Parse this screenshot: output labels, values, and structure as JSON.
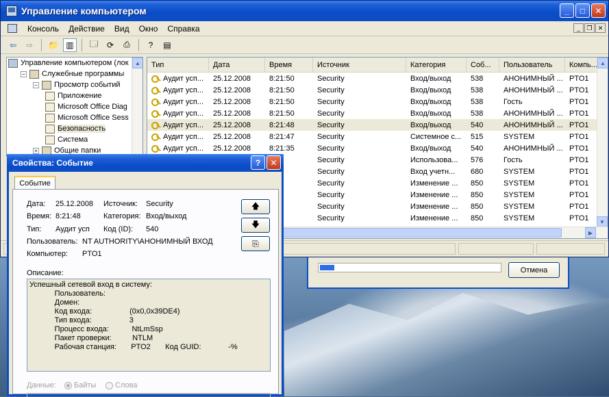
{
  "window": {
    "title": "Управление компьютером"
  },
  "menu": [
    "Консоль",
    "Действие",
    "Вид",
    "Окно",
    "Справка"
  ],
  "tree": [
    {
      "label": "Управление компьютером (лок",
      "level": 0,
      "expander": ""
    },
    {
      "label": "Служебные программы",
      "level": 1,
      "expander": "−"
    },
    {
      "label": "Просмотр событий",
      "level": 2,
      "expander": "−"
    },
    {
      "label": "Приложение",
      "level": 3,
      "expander": ""
    },
    {
      "label": "Microsoft Office Diag",
      "level": 3,
      "expander": ""
    },
    {
      "label": "Microsoft Office Sess",
      "level": 3,
      "expander": ""
    },
    {
      "label": "Безопасность",
      "level": 3,
      "expander": "",
      "selected": true
    },
    {
      "label": "Система",
      "level": 3,
      "expander": ""
    },
    {
      "label": "Общие папки",
      "level": 2,
      "expander": "+"
    }
  ],
  "list": {
    "columns": [
      "Тип",
      "Дата",
      "Время",
      "Источник",
      "Категория",
      "Соб...",
      "Пользователь",
      "Компь..."
    ],
    "rows": [
      [
        "Аудит усп...",
        "25.12.2008",
        "8:21:50",
        "Security",
        "Вход/выход",
        "538",
        "АНОНИМНЫЙ ...",
        "PTO1"
      ],
      [
        "Аудит усп...",
        "25.12.2008",
        "8:21:50",
        "Security",
        "Вход/выход",
        "538",
        "АНОНИМНЫЙ ...",
        "PTO1"
      ],
      [
        "Аудит усп...",
        "25.12.2008",
        "8:21:50",
        "Security",
        "Вход/выход",
        "538",
        "Гость",
        "PTO1"
      ],
      [
        "Аудит усп...",
        "25.12.2008",
        "8:21:50",
        "Security",
        "Вход/выход",
        "538",
        "АНОНИМНЫЙ ...",
        "PTO1"
      ],
      [
        "Аудит усп...",
        "25.12.2008",
        "8:21:48",
        "Security",
        "Вход/выход",
        "540",
        "АНОНИМНЫЙ ...",
        "PTO1"
      ],
      [
        "Аудит усп...",
        "25.12.2008",
        "8:21:47",
        "Security",
        "Системное с...",
        "515",
        "SYSTEM",
        "PTO1"
      ],
      [
        "Аудит усп...",
        "25.12.2008",
        "8:21:35",
        "Security",
        "Вход/выход",
        "540",
        "АНОНИМНЫЙ ...",
        "PTO1"
      ],
      [
        "",
        "",
        "28",
        "Security",
        "Использова...",
        "576",
        "Гость",
        "PTO1"
      ],
      [
        "",
        "",
        "28",
        "Security",
        "Вход учетн...",
        "680",
        "SYSTEM",
        "PTO1"
      ],
      [
        "",
        "",
        "17",
        "Security",
        "Изменение ...",
        "850",
        "SYSTEM",
        "PTO1"
      ],
      [
        "",
        "",
        "17",
        "Security",
        "Изменение ...",
        "850",
        "SYSTEM",
        "PTO1"
      ],
      [
        "",
        "",
        "17",
        "Security",
        "Изменение ...",
        "850",
        "SYSTEM",
        "PTO1"
      ],
      [
        "",
        "",
        "17",
        "Security",
        "Изменение ...",
        "850",
        "SYSTEM",
        "PTO1"
      ]
    ]
  },
  "progress": {
    "cancel_label": "Отмена",
    "value_percent": 8
  },
  "props": {
    "title": "Свойства: Событие",
    "tab": "Событие",
    "date_label": "Дата:",
    "date": "25.12.2008",
    "source_label": "Источник:",
    "source": "Security",
    "time_label": "Время:",
    "time": "8:21:48",
    "category_label": "Категория:",
    "category": "Вход/выход",
    "type_label": "Тип:",
    "type": "Аудит усп",
    "id_label": "Код (ID):",
    "id": "540",
    "user_label": "Пользователь:",
    "user": "NT AUTHORITY\\АНОНИМНЫЙ ВХОД",
    "computer_label": "Компьютер:",
    "computer": "PTO1",
    "desc_label": "Описание:",
    "description": [
      "Успешный сетевой вход в систему:",
      "            Пользователь:",
      "            Домен:",
      "            Код входа:                  (0x0,0x39DE4)",
      "            Тип входа:                  3",
      "            Процесс входа:           NtLmSsp",
      "            Пакет проверки:          NTLM",
      "            Рабочая станция:       PTO2       Код GUID:             -%"
    ],
    "data_label": "Данные:",
    "bytes_label": "Байты",
    "words_label": "Слова"
  }
}
